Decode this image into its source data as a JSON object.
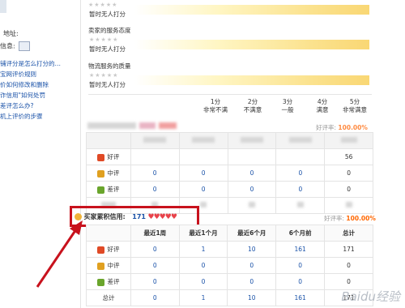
{
  "sidebar": {
    "address_label": "地址:",
    "info_label": "信息:",
    "links": [
      "铺评分是怎么打分的…",
      "宝网评价规则",
      "价如何修改和删除",
      "诈信用\"如何处罚",
      "差评怎么办?",
      "机上评价的步骤"
    ]
  },
  "ratings": [
    {
      "label": "",
      "value_text": "暂时无人打分"
    },
    {
      "label": "卖家的服务态度",
      "value_text": "暂时无人打分"
    },
    {
      "label": "物流服务的质量",
      "value_text": "暂时无人打分"
    }
  ],
  "scale": [
    {
      "score": "1分",
      "desc": "非常不满"
    },
    {
      "score": "2分",
      "desc": "不满意"
    },
    {
      "score": "3分",
      "desc": "一般"
    },
    {
      "score": "4分",
      "desc": "满意"
    },
    {
      "score": "5分",
      "desc": "非常满意"
    }
  ],
  "seller_block": {
    "rate_label": "好评率:",
    "rate_value": "100.00%",
    "rows": [
      {
        "label": "好评",
        "icon": "good-rating-icon",
        "values": [
          "",
          "",
          "",
          "",
          "56"
        ]
      },
      {
        "label": "中评",
        "icon": "neutral-rating-icon",
        "values": [
          "0",
          "0",
          "0",
          "0",
          "0"
        ]
      },
      {
        "label": "差评",
        "icon": "bad-rating-icon",
        "values": [
          "0",
          "0",
          "0",
          "0",
          "0"
        ]
      }
    ]
  },
  "buyer_block": {
    "title": "买家累积信用:",
    "score": "171",
    "hearts": "♥♥♥♥♥",
    "rate_label": "好评率:",
    "rate_value": "100.00%",
    "headers": [
      "",
      "最近1周",
      "最近1个月",
      "最近6个月",
      "6个月前",
      "总计"
    ],
    "rows": [
      {
        "label": "好评",
        "icon": "good-rating-icon",
        "values": [
          "0",
          "1",
          "10",
          "161",
          "171"
        ]
      },
      {
        "label": "中评",
        "icon": "neutral-rating-icon",
        "values": [
          "0",
          "0",
          "0",
          "0",
          "0"
        ]
      },
      {
        "label": "差评",
        "icon": "bad-rating-icon",
        "values": [
          "0",
          "0",
          "0",
          "0",
          "0"
        ]
      },
      {
        "label": "总计",
        "icon": "",
        "values": [
          "0",
          "1",
          "10",
          "161",
          "171"
        ]
      }
    ]
  },
  "stars_glyph": "★★★★★",
  "watermark": "Baidu经验",
  "colors": {
    "accent_red": "#c8121d",
    "rate_orange": "#ff6600",
    "link_blue": "#1a52a8"
  }
}
